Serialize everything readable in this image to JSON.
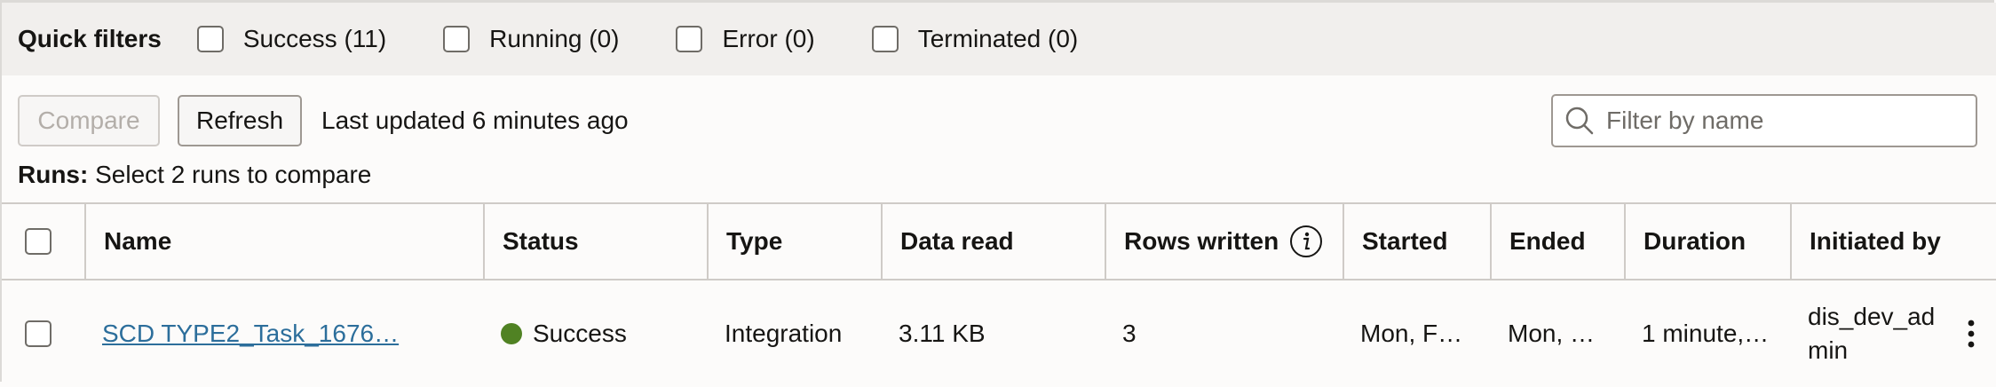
{
  "quick_filters": {
    "title": "Quick filters",
    "items": [
      {
        "label": "Success (11)"
      },
      {
        "label": "Running (0)"
      },
      {
        "label": "Error (0)"
      },
      {
        "label": "Terminated (0)"
      }
    ]
  },
  "toolbar": {
    "compare_label": "Compare",
    "refresh_label": "Refresh",
    "last_updated": "Last updated 6 minutes ago"
  },
  "filter": {
    "placeholder": "Filter by name",
    "icon": "search-icon"
  },
  "runs": {
    "label": "Runs:",
    "hint": "Select 2 runs to compare"
  },
  "table": {
    "headers": {
      "name": "Name",
      "status": "Status",
      "type": "Type",
      "data_read": "Data read",
      "rows_written": "Rows written",
      "started": "Started",
      "ended": "Ended",
      "duration": "Duration",
      "initiated_by": "Initiated by"
    },
    "rows": [
      {
        "name": "SCD TYPE2_Task_1676…",
        "status": "Success",
        "status_color": "#508223",
        "type": "Integration",
        "data_read": "3.11 KB",
        "rows_written": "3",
        "started": "Mon, F…",
        "ended": "Mon, …",
        "duration": "1 minute,…",
        "initiated_by": "dis_dev_ad min"
      }
    ]
  }
}
